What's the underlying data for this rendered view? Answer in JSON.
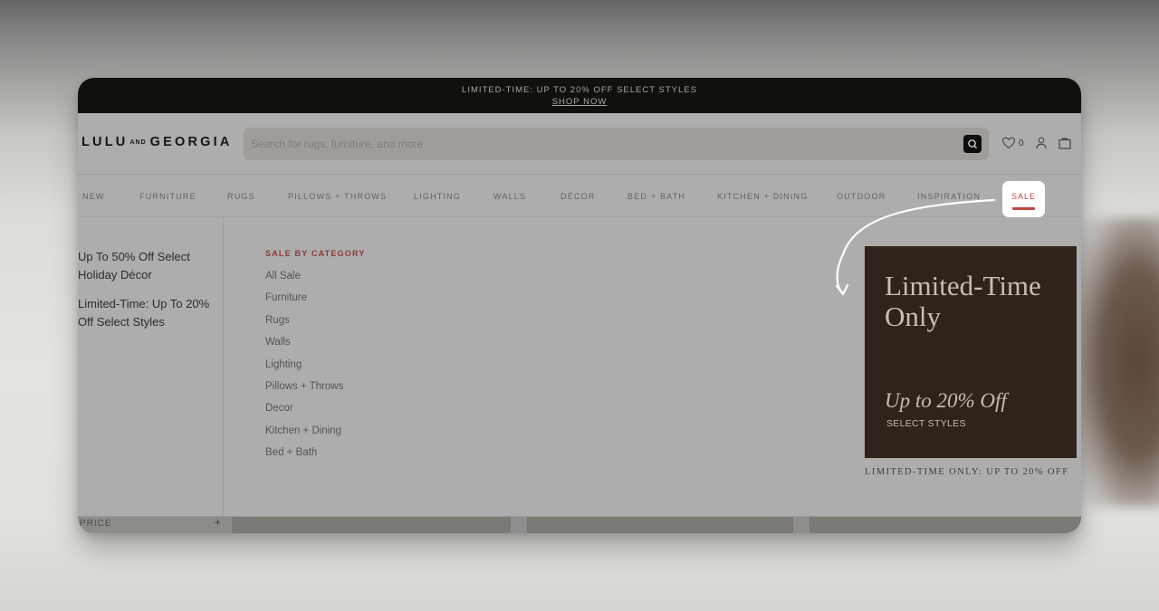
{
  "promo_bar": {
    "text": "LIMITED-TIME: UP TO 20% OFF SELECT STYLES",
    "link": "SHOP NOW"
  },
  "header": {
    "logo_left": "LULU",
    "logo_and": "AND",
    "logo_right": "GEORGIA",
    "search_placeholder": "Search for rugs, furniture, and more",
    "search_icon": "search-icon",
    "wishlist_icon": "heart-icon",
    "wishlist_count": "0",
    "account_icon": "user-icon",
    "cart_icon": "shopping-bag-icon"
  },
  "nav": {
    "items": [
      "NEW",
      "FURNITURE",
      "RUGS",
      "PILLOWS + THROWS",
      "LIGHTING",
      "WALLS",
      "DÉCOR",
      "BED + BATH",
      "KITCHEN + DINING",
      "OUTDOOR",
      "INSPIRATION"
    ],
    "active": "SALE",
    "accent_color": "#c0433e"
  },
  "mega_menu": {
    "sidebar_links": [
      "Up To 50% Off Select Holiday Décor",
      "Limited-Time: Up To 20% Off Select Styles"
    ],
    "category_heading": "SALE BY CATEGORY",
    "categories": [
      "All Sale",
      "Furniture",
      "Rugs",
      "Walls",
      "Lighting",
      "Pillows + Throws",
      "Decor",
      "Kitchen + Dining",
      "Bed + Bath"
    ],
    "promo": {
      "title": "Limited-Time Only",
      "offer": "Up to 20% Off",
      "sub": "SELECT STYLES",
      "caption": "LIMITED-TIME ONLY: UP TO 20% OFF",
      "bg_color": "#2f231c"
    }
  },
  "filters": {
    "price_label": "PRICE",
    "expand_symbol": "+"
  }
}
